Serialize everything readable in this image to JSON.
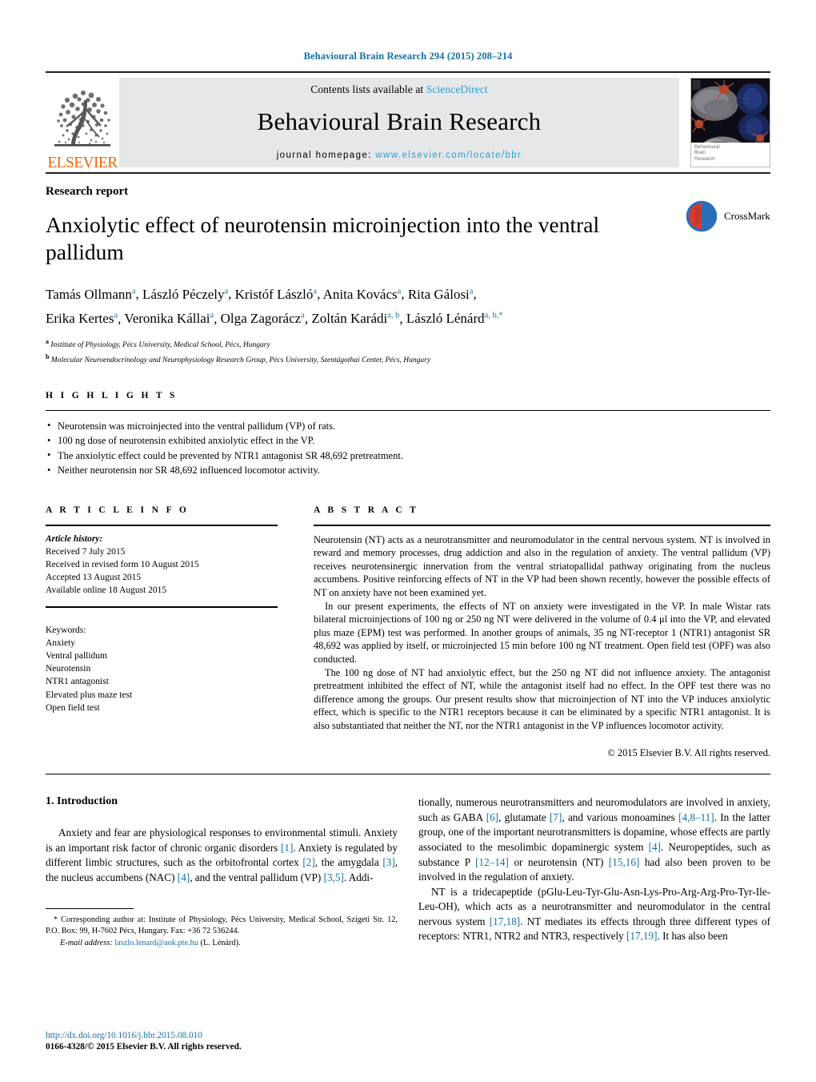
{
  "running_head": "Behavioural Brain Research 294 (2015) 208–214",
  "masthead": {
    "contents_prefix": "Contents lists available at ",
    "sciencedirect": "ScienceDirect",
    "journal_name": "Behavioural Brain Research",
    "homepage_label": "journal homepage:",
    "homepage_url": "www.elsevier.com/locate/bbr",
    "publisher_logo_text": "ELSEVIER",
    "cover_caption_line1": "Behavioural",
    "cover_caption_line2": "Brain",
    "cover_caption_line3": "Research",
    "cover_caption_tiny": "ELSEVIER"
  },
  "article": {
    "kind": "Research report",
    "title": "Anxiolytic effect of neurotensin microinjection into the ventral pallidum",
    "crossmark_label": "CrossMark",
    "authors_line1": [
      {
        "name": "Tamás Ollmann",
        "sup": "a"
      },
      {
        "name": "László Péczely",
        "sup": "a"
      },
      {
        "name": "Kristóf László",
        "sup": "a"
      },
      {
        "name": "Anita Kovács",
        "sup": "a"
      },
      {
        "name": "Rita Gálosi",
        "sup": "a"
      }
    ],
    "authors_line2": [
      {
        "name": "Erika Kertes",
        "sup": "a"
      },
      {
        "name": "Veronika Kállai",
        "sup": "a"
      },
      {
        "name": "Olga Zagorácz",
        "sup": "a"
      },
      {
        "name": "Zoltán Karádi",
        "sup": "a, b"
      },
      {
        "name": "László Lénárd",
        "sup": "a, b,"
      }
    ],
    "affiliations": [
      {
        "mark": "a",
        "text": "Institute of Physiology, Pécs University, Medical School, Pécs, Hungary"
      },
      {
        "mark": "b",
        "text": "Molecular Neuroendocrinology and Neurophysiology Research Group, Pécs University, Szentágothai Center, Pécs, Hungary"
      }
    ]
  },
  "highlights": {
    "heading": "H I G H L I G H T S",
    "items": [
      "Neurotensin was microinjected into the ventral pallidum (VP) of rats.",
      "100 ng dose of neurotensin exhibited anxiolytic effect in the VP.",
      "The anxiolytic effect could be prevented by NTR1 antagonist SR 48,692 pretreatment.",
      "Neither neurotensin nor SR 48,692 influenced locomotor activity."
    ]
  },
  "article_info": {
    "heading": "A R T I C L E    I N F O",
    "history_label": "Article history:",
    "history": [
      "Received 7 July 2015",
      "Received in revised form 10 August 2015",
      "Accepted 13 August 2015",
      "Available online 18 August 2015"
    ],
    "keywords_label": "Keywords:",
    "keywords": [
      "Anxiety",
      "Ventral pallidum",
      "Neurotensin",
      "NTR1 antagonist",
      "Elevated plus maze test",
      "Open field test"
    ]
  },
  "abstract": {
    "heading": "A B S T R A C T",
    "paragraphs": [
      "Neurotensin (NT) acts as a neurotransmitter and neuromodulator in the central nervous system. NT is involved in reward and memory processes, drug addiction and also in the regulation of anxiety. The ventral pallidum (VP) receives neurotensinergic innervation from the ventral striatopallidal pathway originating from the nucleus accumbens. Positive reinforcing effects of NT in the VP had been shown recently, however the possible effects of NT on anxiety have not been examined yet.",
      "In our present experiments, the effects of NT on anxiety were investigated in the VP. In male Wistar rats bilateral microinjections of 100 ng or 250 ng NT were delivered in the volume of 0.4 μl into the VP, and elevated plus maze (EPM) test was performed. In another groups of animals, 35 ng NT-receptor 1 (NTR1) antagonist SR 48,692 was applied by itself, or microinjected 15 min before 100 ng NT treatment. Open field test (OPF) was also conducted.",
      "The 100 ng dose of NT had anxiolytic effect, but the 250 ng NT did not influence anxiety. The antagonist pretreatment inhibited the effect of NT, while the antagonist itself had no effect. In the OPF test there was no difference among the groups. Our present results show that microinjection of NT into the VP induces anxiolytic effect, which is specific to the NTR1 receptors because it can be eliminated by a specific NTR1 antagonist. It is also substantiated that neither the NT, nor the NTR1 antagonist in the VP influences locomotor activity."
    ],
    "copyright": "© 2015 Elsevier B.V. All rights reserved."
  },
  "introduction": {
    "heading": "1.  Introduction",
    "left_paragraph_parts": [
      {
        "t": "Anxiety and fear are physiological responses to environmental stimuli. Anxiety is an important risk factor of chronic organic disorders "
      },
      {
        "t": "[1]",
        "ref": true
      },
      {
        "t": ". Anxiety is regulated by different limbic structures, such as the orbitofrontal cortex "
      },
      {
        "t": "[2]",
        "ref": true
      },
      {
        "t": ", the amygdala "
      },
      {
        "t": "[3]",
        "ref": true
      },
      {
        "t": ", the nucleus accumbens (NAC) "
      },
      {
        "t": "[4]",
        "ref": true
      },
      {
        "t": ", and the ventral pallidum (VP) "
      },
      {
        "t": "[3,5]",
        "ref": true
      },
      {
        "t": ". Addi-"
      }
    ],
    "right_paragraph1_parts": [
      {
        "t": "tionally, numerous neurotransmitters and neuromodulators are involved in anxiety, such as GABA "
      },
      {
        "t": "[6]",
        "ref": true
      },
      {
        "t": ", glutamate "
      },
      {
        "t": "[7]",
        "ref": true
      },
      {
        "t": ", and various monoamines "
      },
      {
        "t": "[4,8–11]",
        "ref": true
      },
      {
        "t": ". In the latter group, one of the important neurotransmitters is dopamine, whose effects are partly associated to the mesolimbic dopaminergic system "
      },
      {
        "t": "[4]",
        "ref": true
      },
      {
        "t": ". Neuropeptides, such as substance P "
      },
      {
        "t": "[12–14]",
        "ref": true
      },
      {
        "t": " or neurotensin (NT) "
      },
      {
        "t": "[15,16]",
        "ref": true
      },
      {
        "t": " had also been proven to be involved in the regulation of anxiety."
      }
    ],
    "right_paragraph2_parts": [
      {
        "t": "NT is a tridecapeptide (pGlu-Leu-Tyr-Glu-Asn-Lys-Pro-Arg-Arg-Pro-Tyr-Ile-Leu-OH), which acts as a neurotransmitter and neuromodulator in the central nervous system "
      },
      {
        "t": "[17,18]",
        "ref": true
      },
      {
        "t": ". NT mediates its effects through three different types of receptors: NTR1, NTR2 and NTR3, respectively "
      },
      {
        "t": "[17,19]",
        "ref": true
      },
      {
        "t": ". It has also been"
      }
    ]
  },
  "footnote": {
    "star": "*",
    "corresponding": "Corresponding author at: Institute of Physiology, Pécs University, Medical School, Szigeti Str. 12, P.O. Box: 99, H-7602 Pécs, Hungary. Fax: +36 72 536244.",
    "email_label": "E-mail address:",
    "email": "laszlo.lenard@aok.pte.hu",
    "email_owner": "(L. Lénárd)."
  },
  "footer": {
    "doi": "http://dx.doi.org/10.1016/j.bbr.2015.08.010",
    "issn": "0166-4328/© 2015 Elsevier B.V. All rights reserved."
  },
  "colors": {
    "link": "#1470a5",
    "sciencedirect": "#2a9fd6",
    "elsevier_orange": "#ec6608",
    "mast_bg": "#e6e7e8"
  }
}
